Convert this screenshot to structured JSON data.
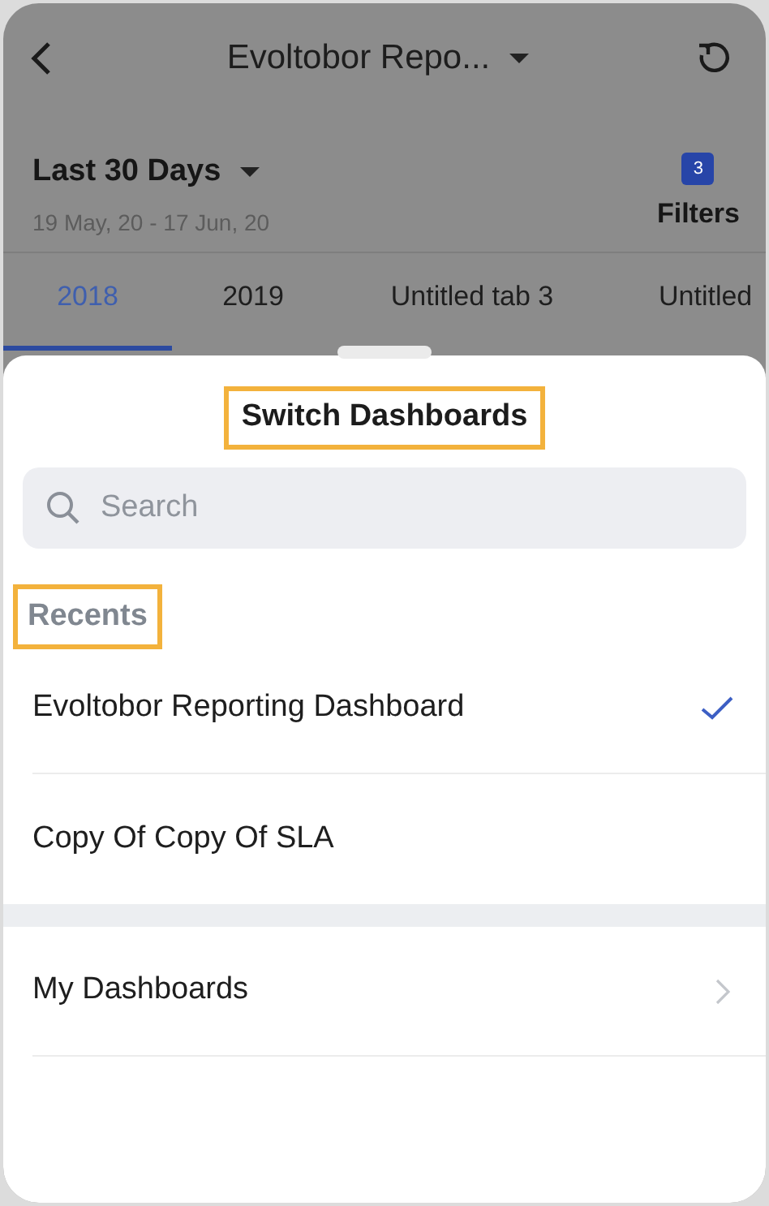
{
  "header": {
    "title": "Evoltobor Repo...",
    "date_range": "Last 30 Days",
    "date_detail": "19 May, 20 - 17 Jun, 20",
    "filters": {
      "count": "3",
      "label": "Filters"
    }
  },
  "tabs": [
    {
      "label": "2018",
      "selected": true
    },
    {
      "label": "2019",
      "selected": false
    },
    {
      "label": "Untitled tab 3",
      "selected": false
    },
    {
      "label": "Untitled",
      "selected": false
    }
  ],
  "sheet": {
    "title": {
      "text": "Switch Dashboards",
      "highlighted": true
    },
    "search": {
      "placeholder": "Search"
    },
    "recents": {
      "label": {
        "text": "Recents",
        "highlighted": true
      },
      "items": [
        {
          "name": "Evoltobor Reporting Dashboard",
          "checked": true
        },
        {
          "name": "Copy Of Copy Of SLA",
          "checked": false
        }
      ]
    },
    "folders": [
      {
        "name": "My Dashboards"
      }
    ]
  }
}
